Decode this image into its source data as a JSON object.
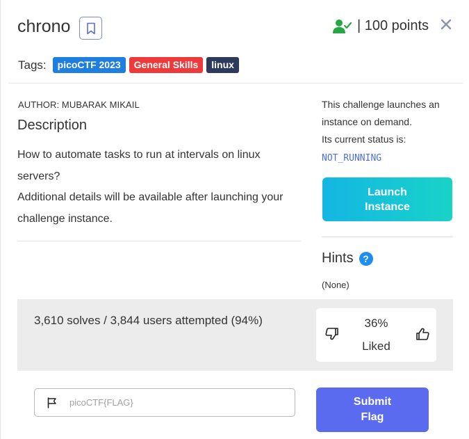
{
  "challenge": {
    "name": "chrono",
    "points_text": "| 100 points"
  },
  "tags": {
    "label": "Tags:",
    "items": [
      {
        "text": "picoCTF 2023",
        "color": "#1f7fe0"
      },
      {
        "text": "General Skills",
        "color": "#ee3a3a"
      },
      {
        "text": "linux",
        "color": "#2d3a5c"
      }
    ]
  },
  "author": "AUTHOR: MUBARAK MIKAIL",
  "description": {
    "heading": "Description",
    "line1": "How to automate tasks to run at intervals on linux servers?",
    "line2": "Additional details will be available after launching your challenge instance."
  },
  "instance": {
    "info_line1": "This challenge launches an instance on demand.",
    "info_line2": "Its current status is:",
    "status": "NOT_RUNNING",
    "launch_label_1": "Launch",
    "launch_label_2": "Instance"
  },
  "hints": {
    "heading": "Hints",
    "help_glyph": "?",
    "body": "(None)"
  },
  "stats": {
    "solves_text": "3,610 solves / 3,844 users attempted (94%)",
    "liked_percent": "36%",
    "liked_label": "Liked"
  },
  "flag_form": {
    "placeholder": "picoCTF{FLAG}",
    "value": "",
    "submit_label_1": "Submit",
    "submit_label_2": "Flag"
  },
  "icons": {
    "bookmark": "bookmark-icon",
    "solved_user": "user-check-icon",
    "close": "close-icon",
    "thumbs_down": "thumbs-down-icon",
    "thumbs_up": "thumbs-up-icon",
    "flag": "flag-icon"
  },
  "colors": {
    "accent_blue": "#5b6bf0",
    "launch_gradient_start": "#14b6e3",
    "launch_gradient_end": "#18d3c8",
    "solved_green": "#28a745",
    "status_blue": "#4a6ee0",
    "help_blue": "#1f8ef1"
  }
}
